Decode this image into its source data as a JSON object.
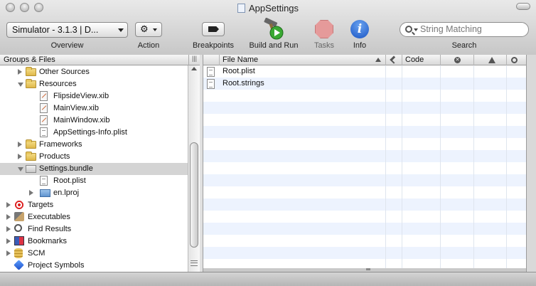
{
  "window": {
    "title": "AppSettings"
  },
  "toolbar": {
    "overview": {
      "value": "Simulator - 3.1.3 | D...",
      "label": "Overview"
    },
    "action": {
      "icon": "gear-icon",
      "label": "Action"
    },
    "breakpoints": {
      "icon": "breakpoint-icon",
      "label": "Breakpoints"
    },
    "build": {
      "icon": "hammer-icon",
      "label": "Build and Run"
    },
    "tasks": {
      "icon": "stop-icon",
      "label": "Tasks",
      "color": "#e59a9a"
    },
    "info": {
      "icon": "info-icon",
      "glyph": "i",
      "label": "Info",
      "color": "#1a55c4"
    },
    "search": {
      "placeholder": "String Matching",
      "label": "Search"
    }
  },
  "sidebar": {
    "header": "Groups & Files",
    "items": [
      {
        "label": "Other Sources",
        "icon": "folder-icon",
        "depth": 1,
        "disclosure": "closed"
      },
      {
        "label": "Resources",
        "icon": "folder-icon",
        "depth": 1,
        "disclosure": "open"
      },
      {
        "label": "FlipsideView.xib",
        "icon": "xib-icon",
        "depth": 2,
        "disclosure": "none"
      },
      {
        "label": "MainView.xib",
        "icon": "xib-icon",
        "depth": 2,
        "disclosure": "none"
      },
      {
        "label": "MainWindow.xib",
        "icon": "xib-icon",
        "depth": 2,
        "disclosure": "none"
      },
      {
        "label": "AppSettings-Info.plist",
        "icon": "plist-icon",
        "depth": 2,
        "disclosure": "none"
      },
      {
        "label": "Frameworks",
        "icon": "folder-icon",
        "depth": 1,
        "disclosure": "closed"
      },
      {
        "label": "Products",
        "icon": "folder-icon",
        "depth": 1,
        "disclosure": "closed"
      },
      {
        "label": "Settings.bundle",
        "icon": "bundle-icon",
        "depth": 1,
        "disclosure": "open",
        "selected": true
      },
      {
        "label": "Root.plist",
        "icon": "plist-icon",
        "depth": 2,
        "disclosure": "none"
      },
      {
        "label": "en.lproj",
        "icon": "blue-folder-icon",
        "depth": 2,
        "disclosure": "closed"
      },
      {
        "label": "Targets",
        "icon": "target-icon",
        "depth": 0,
        "disclosure": "closed"
      },
      {
        "label": "Executables",
        "icon": "executable-icon",
        "depth": 0,
        "disclosure": "closed"
      },
      {
        "label": "Find Results",
        "icon": "magnifier-icon",
        "depth": 0,
        "disclosure": "closed"
      },
      {
        "label": "Bookmarks",
        "icon": "bookmark-icon",
        "depth": 0,
        "disclosure": "closed"
      },
      {
        "label": "SCM",
        "icon": "scm-icon",
        "depth": 0,
        "disclosure": "closed"
      },
      {
        "label": "Project Symbols",
        "icon": "symbols-icon",
        "depth": 0,
        "disclosure": "none"
      }
    ]
  },
  "file_list": {
    "columns": [
      "File Name",
      "Code"
    ],
    "column_icons": [
      "build-column-icon",
      "errors-column-icon",
      "warnings-column-icon",
      "target-membership-icon"
    ],
    "rows": [
      "Root.plist",
      "Root.strings"
    ]
  }
}
